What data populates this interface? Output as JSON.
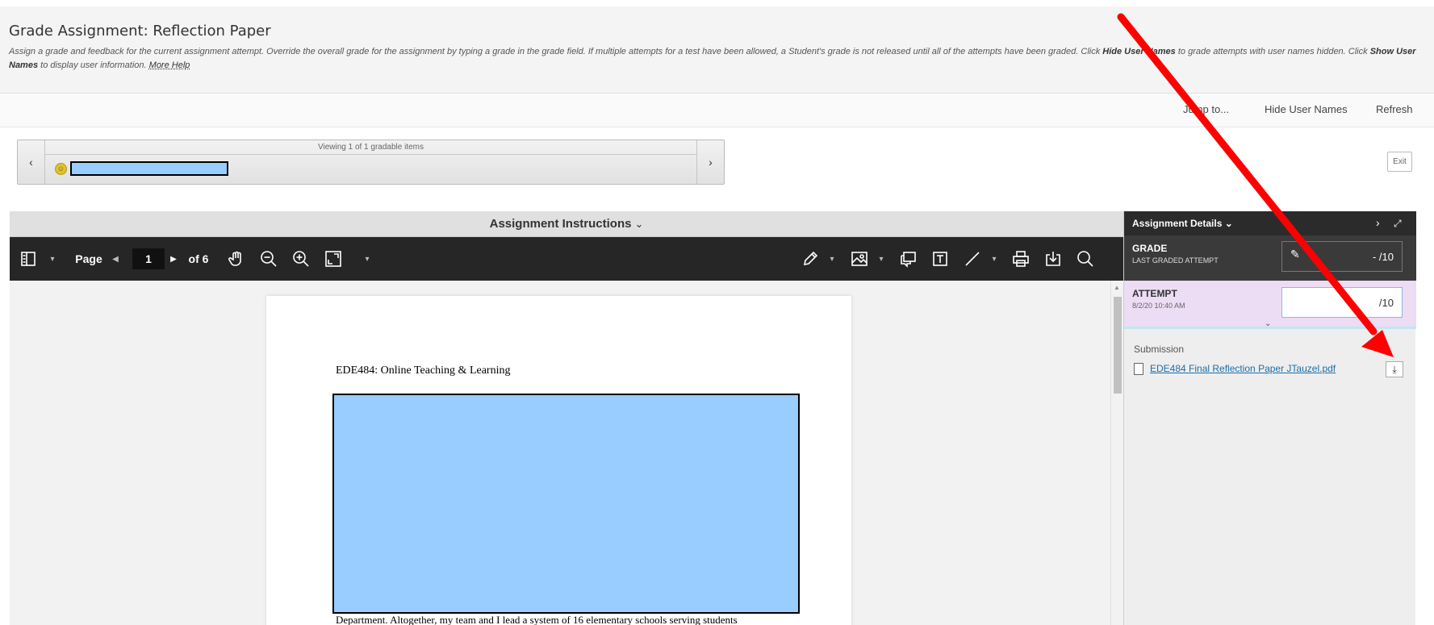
{
  "header": {
    "title": "Grade Assignment: Reflection Paper",
    "instructions_part1": "Assign a grade and feedback for the current assignment attempt. Override the overall grade for the assignment by typing a grade in the grade field. If multiple attempts for a test have been allowed, a Student's grade is not released until all of the attempts have been graded. Click ",
    "hide_names_bold": "Hide User Names",
    "instructions_part2": " to grade attempts with user names hidden. Click ",
    "show_names_bold": "Show User Names",
    "instructions_part3": " to display user information. ",
    "more_help": "More Help"
  },
  "actionbar": {
    "jump_to": "Jump to...",
    "hide_user_names": "Hide User Names",
    "refresh": "Refresh"
  },
  "navigator": {
    "caption": "Viewing 1 of 1 gradable items",
    "prev_icon": "chevron-left-icon",
    "next_icon": "chevron-right-icon"
  },
  "exit_label": "Exit",
  "viewer": {
    "title": "Assignment Instructions",
    "page_label": "Page",
    "page_number": "1",
    "page_total": "of 6"
  },
  "document": {
    "heading": "EDE484: Online Teaching & Learning",
    "visible_line": "Department.  Altogether, my team and I lead a system of 16 elementary schools serving students"
  },
  "panel": {
    "title": "Assignment Details",
    "grade_label": "GRADE",
    "grade_sub": "LAST GRADED ATTEMPT",
    "grade_value": "- /10",
    "attempt_label": "ATTEMPT",
    "attempt_date": "8/2/20 10:40 AM",
    "attempt_value": "/10",
    "submission_label": "Submission",
    "file_name": "EDE484 Final Reflection Paper JTauzel.pdf"
  },
  "colors": {
    "toolbar_bg": "#262626",
    "panel_head_bg": "#2b2b2b",
    "attempt_bg": "#ecdcf4",
    "redaction": "#99ccff",
    "arrow": "#ff0000",
    "link": "#1a6ea8"
  }
}
